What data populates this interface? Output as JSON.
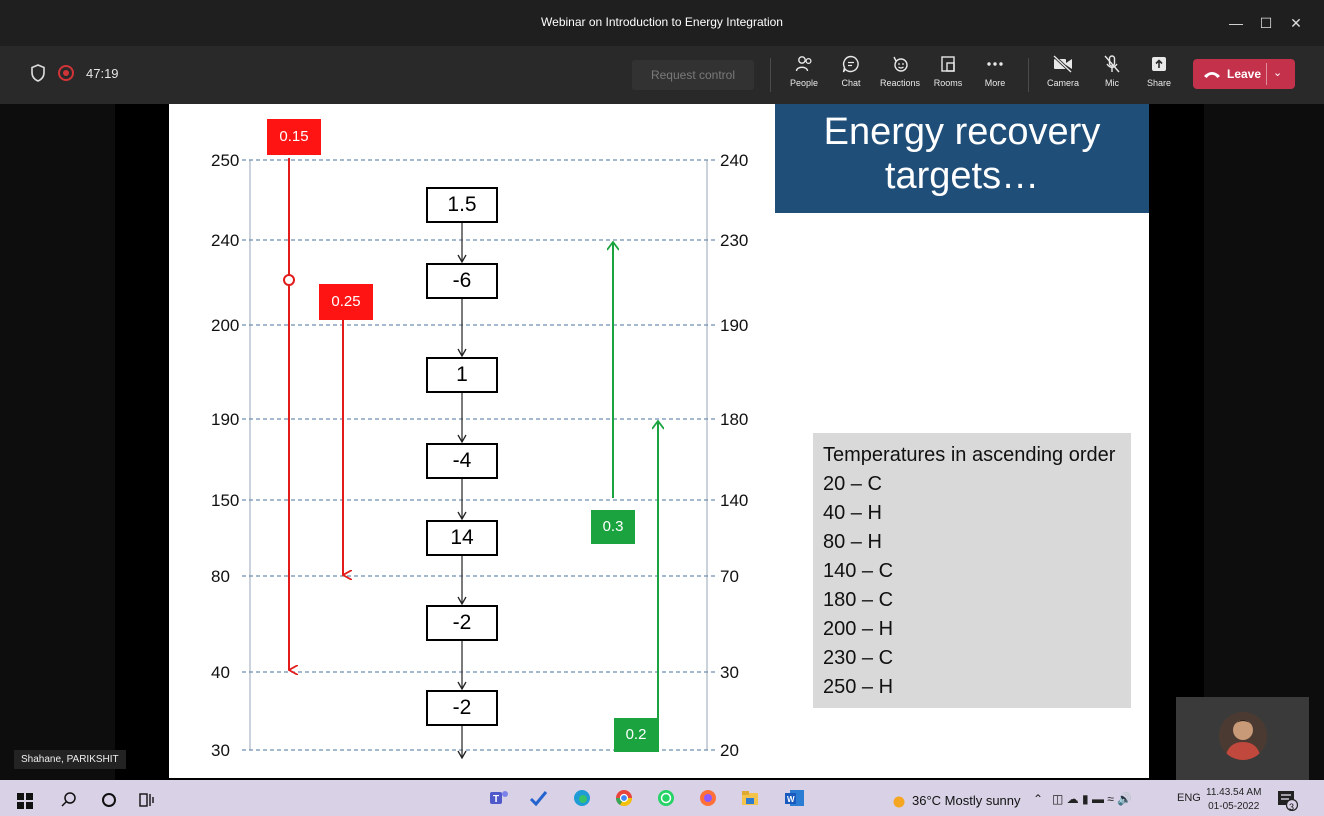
{
  "window": {
    "title": "Webinar on Introduction to Energy Integration"
  },
  "meeting": {
    "timer": "47:19",
    "request_control": "Request control",
    "buttons": {
      "people": "People",
      "chat": "Chat",
      "reactions": "Reactions",
      "rooms": "Rooms",
      "more": "More",
      "camera": "Camera",
      "mic": "Mic",
      "share": "Share",
      "leave": "Leave"
    },
    "presenter_name": "Shahane, PARIKSHIT"
  },
  "slide": {
    "title": "Energy recovery targets…",
    "left_axis": [
      "250",
      "240",
      "200",
      "190",
      "150",
      "80",
      "40",
      "30"
    ],
    "right_axis": [
      "240",
      "230",
      "190",
      "180",
      "140",
      "70",
      "30",
      "20"
    ],
    "interval_values": [
      "1.5",
      "-6",
      "1",
      "-4",
      "14",
      "-2",
      "-2"
    ],
    "hot_streams": [
      "0.15",
      "0.25"
    ],
    "cold_streams": [
      "0.3",
      "0.2"
    ],
    "temps_heading": "Temperatures in ascending order",
    "temps": [
      "20 – C",
      "40 – H",
      "80 – H",
      "140 – C",
      "180 – C",
      "200 – H",
      "230 – C",
      "250 – H"
    ]
  },
  "taskbar": {
    "weather": "36°C  Mostly sunny",
    "language": "ENG",
    "time": "11.43.54 AM",
    "date": "01-05-2022",
    "notifications": "3"
  },
  "colors": {
    "hot_stream": "#e31b1b",
    "cold_stream": "#1aa33f",
    "title_box": "#1f4e79",
    "leave_button": "#c4314b"
  }
}
